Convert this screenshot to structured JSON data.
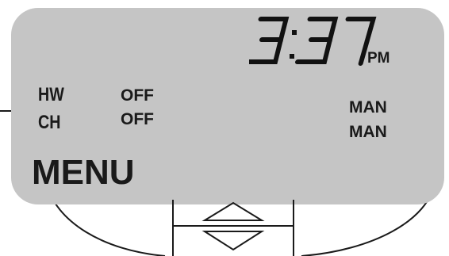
{
  "display": {
    "time": "3:37",
    "ampm": "PM"
  },
  "rows": [
    {
      "label": "HW",
      "state": "OFF",
      "mode": "MAN"
    },
    {
      "label": "CH",
      "state": "OFF",
      "mode": "MAN"
    }
  ],
  "menu_label": "MENU",
  "colors": {
    "lcd_background": "#c5c5c5",
    "segment": "#111111"
  },
  "icons": {
    "up": "up-arrow-outline-icon",
    "down": "down-arrow-outline-icon"
  }
}
